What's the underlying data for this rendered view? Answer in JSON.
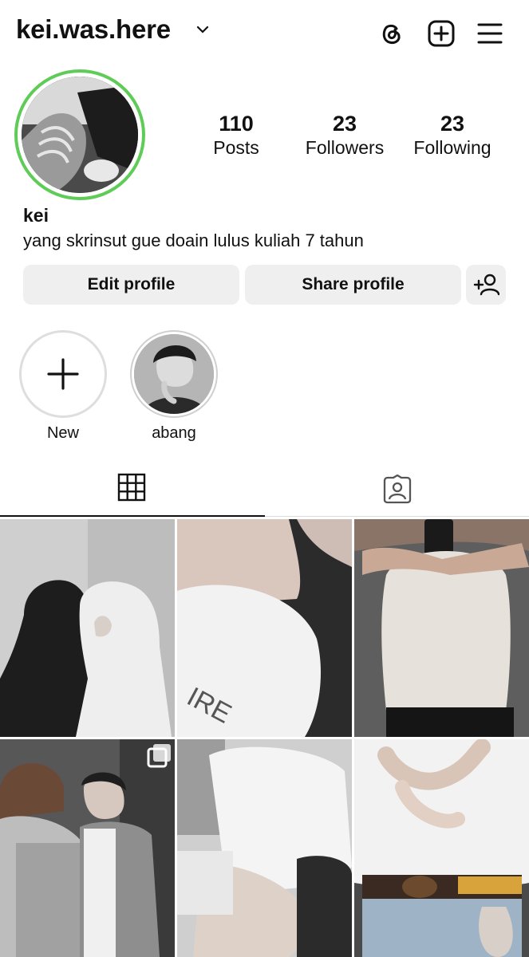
{
  "header": {
    "username": "kei.was.here",
    "icons": [
      "threads-icon",
      "create-post-icon",
      "menu-icon"
    ]
  },
  "profile": {
    "stats": [
      {
        "value": "110",
        "label": "Posts"
      },
      {
        "value": "23",
        "label": "Followers"
      },
      {
        "value": "23",
        "label": "Following"
      }
    ],
    "name": "kei",
    "bio": "yang skrinsut gue doain lulus kuliah 7 tahun"
  },
  "buttons": {
    "edit": "Edit profile",
    "share": "Share profile"
  },
  "highlights": [
    {
      "label": "New"
    },
    {
      "label": "abang"
    }
  ],
  "tabs": [
    "grid-icon",
    "tagged-icon"
  ],
  "colors": {
    "story_ring": "#5fcc57",
    "button_bg": "#efefef",
    "tab_active": "#111111"
  }
}
